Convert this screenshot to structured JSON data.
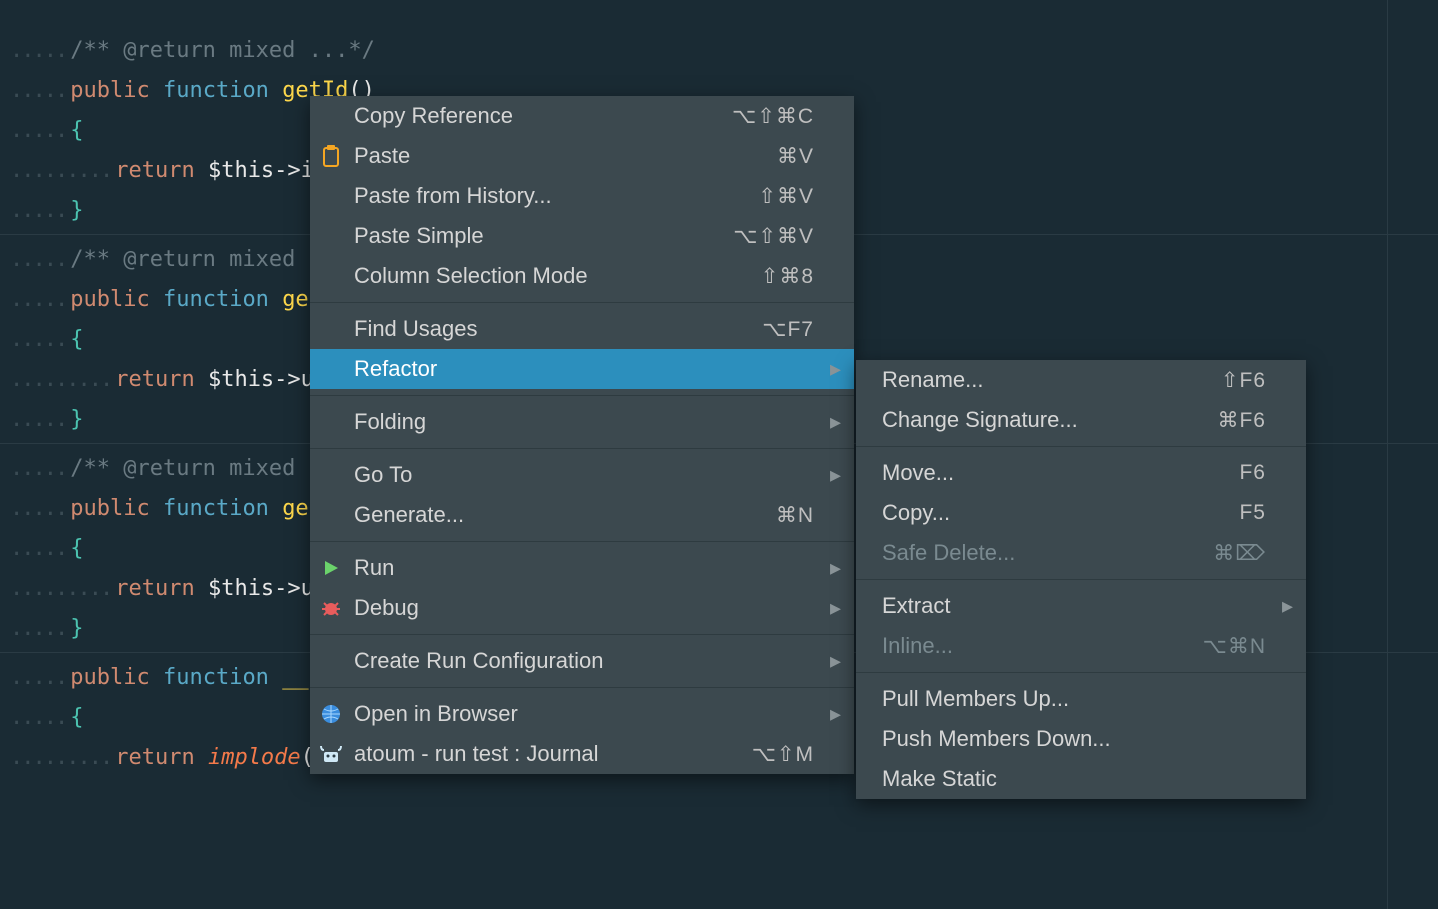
{
  "editor": {
    "lines": [
      {
        "guides": ".....",
        "tokens": [
          {
            "t": "/** @return mixed ...*/",
            "c": "comment"
          }
        ]
      },
      {
        "guides": ".....",
        "tokens": [
          {
            "t": "public",
            "c": "keyword"
          },
          {
            "t": " ",
            "c": ""
          },
          {
            "t": "function",
            "c": "fn"
          },
          {
            "t": " ",
            "c": ""
          },
          {
            "t": "getId",
            "c": "name"
          },
          {
            "t": "()",
            "c": "paren"
          }
        ]
      },
      {
        "guides": ".....",
        "tokens": [
          {
            "t": "{",
            "c": "brace"
          }
        ]
      },
      {
        "guides": ".........",
        "tokens": [
          {
            "t": "return",
            "c": "keyword"
          },
          {
            "t": " ",
            "c": ""
          },
          {
            "t": "$this->i",
            "c": "var"
          }
        ]
      },
      {
        "guides": ".....",
        "tokens": [
          {
            "t": "}",
            "c": "brace"
          }
        ]
      },
      {
        "sep": true
      },
      {
        "guides": ".....",
        "tokens": [
          {
            "t": "/** @return mixed .",
            "c": "comment"
          }
        ]
      },
      {
        "guides": ".....",
        "tokens": [
          {
            "t": "public",
            "c": "keyword"
          },
          {
            "t": " ",
            "c": ""
          },
          {
            "t": "function",
            "c": "fn"
          },
          {
            "t": " ",
            "c": ""
          },
          {
            "t": "getU",
            "c": "name"
          }
        ]
      },
      {
        "guides": ".....",
        "tokens": [
          {
            "t": "{",
            "c": "brace"
          }
        ]
      },
      {
        "guides": ".........",
        "tokens": [
          {
            "t": "return",
            "c": "keyword"
          },
          {
            "t": " ",
            "c": ""
          },
          {
            "t": "$this->u",
            "c": "var"
          }
        ]
      },
      {
        "guides": ".....",
        "tokens": [
          {
            "t": "}",
            "c": "brace"
          }
        ]
      },
      {
        "sep": true
      },
      {
        "guides": ".....",
        "tokens": [
          {
            "t": "/** @return mixed .",
            "c": "comment"
          }
        ]
      },
      {
        "guides": ".....",
        "tokens": [
          {
            "t": "public",
            "c": "keyword"
          },
          {
            "t": " ",
            "c": ""
          },
          {
            "t": "function",
            "c": "fn"
          },
          {
            "t": " ",
            "c": ""
          },
          {
            "t": "getU",
            "c": "name"
          }
        ]
      },
      {
        "guides": ".....",
        "tokens": [
          {
            "t": "{",
            "c": "brace"
          }
        ]
      },
      {
        "guides": ".........",
        "tokens": [
          {
            "t": "return",
            "c": "keyword"
          },
          {
            "t": " ",
            "c": ""
          },
          {
            "t": "$this->u",
            "c": "var"
          }
        ]
      },
      {
        "guides": ".....",
        "tokens": [
          {
            "t": "}",
            "c": "brace"
          }
        ]
      },
      {
        "sep": true
      },
      {
        "guides": ".....",
        "tokens": [
          {
            "t": "public",
            "c": "keyword"
          },
          {
            "t": " ",
            "c": ""
          },
          {
            "t": "function",
            "c": "fn"
          },
          {
            "t": " ",
            "c": ""
          },
          {
            "t": "__t",
            "c": "name"
          }
        ]
      },
      {
        "guides": ".....",
        "tokens": [
          {
            "t": "{",
            "c": "brace"
          }
        ]
      },
      {
        "guides": ".........",
        "tokens": [
          {
            "t": "return",
            "c": "keyword"
          },
          {
            "t": " ",
            "c": ""
          },
          {
            "t": "implode",
            "c": "implode"
          },
          {
            "t": "(",
            "c": "paren"
          }
        ]
      }
    ]
  },
  "main_menu": {
    "items": [
      {
        "icon": "",
        "label": "Copy Reference",
        "shortcut": "⌥⇧⌘C"
      },
      {
        "icon": "clipboard",
        "label": "Paste",
        "shortcut": "⌘V"
      },
      {
        "icon": "",
        "label": "Paste from History...",
        "shortcut": "⇧⌘V"
      },
      {
        "icon": "",
        "label": "Paste Simple",
        "shortcut": "⌥⇧⌘V"
      },
      {
        "icon": "",
        "label": "Column Selection Mode",
        "shortcut": "⇧⌘8"
      },
      {
        "sep": true
      },
      {
        "icon": "",
        "label": "Find Usages",
        "shortcut": "⌥F7"
      },
      {
        "icon": "",
        "label": "Refactor",
        "shortcut": "",
        "submenu": true,
        "highlight": true
      },
      {
        "sep": true
      },
      {
        "icon": "",
        "label": "Folding",
        "shortcut": "",
        "submenu": true
      },
      {
        "sep": true
      },
      {
        "icon": "",
        "label": "Go To",
        "shortcut": "",
        "submenu": true
      },
      {
        "icon": "",
        "label": "Generate...",
        "shortcut": "⌘N"
      },
      {
        "sep": true
      },
      {
        "icon": "play",
        "label": "Run",
        "shortcut": "",
        "submenu": true
      },
      {
        "icon": "bug",
        "label": "Debug",
        "shortcut": "",
        "submenu": true
      },
      {
        "sep": true
      },
      {
        "icon": "",
        "label": "Create Run Configuration",
        "shortcut": "",
        "submenu": true
      },
      {
        "sep": true
      },
      {
        "icon": "globe",
        "label": "Open in Browser",
        "shortcut": "",
        "submenu": true
      },
      {
        "icon": "atoum",
        "label": "atoum - run test : Journal",
        "shortcut": "⌥⇧M"
      }
    ]
  },
  "sub_menu": {
    "items": [
      {
        "label": "Rename...",
        "shortcut": "⇧F6"
      },
      {
        "label": "Change Signature...",
        "shortcut": "⌘F6"
      },
      {
        "sep": true
      },
      {
        "label": "Move...",
        "shortcut": "F6"
      },
      {
        "label": "Copy...",
        "shortcut": "F5"
      },
      {
        "label": "Safe Delete...",
        "shortcut": "⌘⌦",
        "disabled": true
      },
      {
        "sep": true
      },
      {
        "label": "Extract",
        "shortcut": "",
        "submenu": true
      },
      {
        "label": "Inline...",
        "shortcut": "⌥⌘N",
        "disabled": true
      },
      {
        "sep": true
      },
      {
        "label": "Pull Members Up..."
      },
      {
        "label": "Push Members Down..."
      },
      {
        "label": "Make Static"
      }
    ]
  }
}
